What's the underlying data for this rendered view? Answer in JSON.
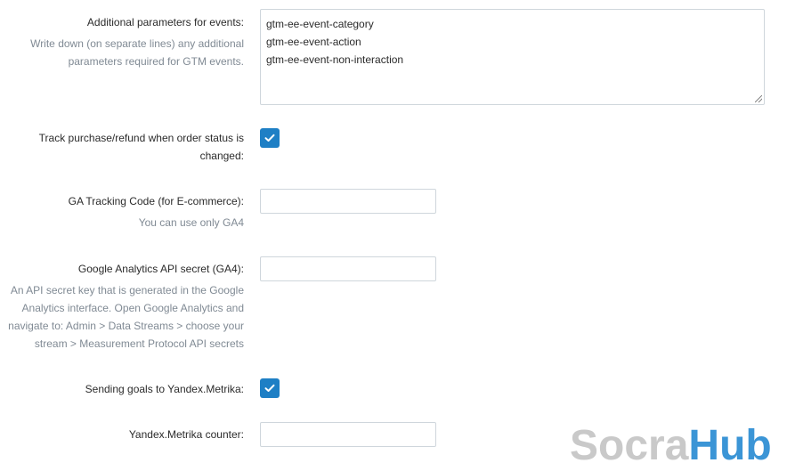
{
  "fields": {
    "additional_params": {
      "label": "Additional parameters for events:",
      "hint_line1": "Write down (on separate lines) any additional",
      "hint_line2": "parameters required for GTM events.",
      "lines": [
        "gtm-ee-event-category",
        "gtm-ee-event-action",
        "gtm-ee-event-non-interaction"
      ]
    },
    "track_purchase": {
      "label_line1": "Track purchase/refund when order status is",
      "label_line2": "changed:",
      "checked": true
    },
    "ga_tracking_code": {
      "label": "GA Tracking Code (for E-commerce):",
      "hint": "You can use only GA4",
      "value": ""
    },
    "ga_api_secret": {
      "label": "Google Analytics API secret (GA4):",
      "hint_line1": "An API secret key that is generated in the Google",
      "hint_line2": "Analytics interface. Open Google Analytics and",
      "hint_line3": "navigate to: Admin > Data Streams > choose your",
      "hint_line4": "stream > Measurement Protocol API secrets",
      "value": ""
    },
    "yandex_goals": {
      "label": "Sending goals to Yandex.Metrika:",
      "checked": true
    },
    "yandex_counter": {
      "label": "Yandex.Metrika counter:",
      "value": ""
    }
  },
  "watermark": {
    "part1": "Socra",
    "part2": "Hub"
  },
  "colors": {
    "checkbox": "#1e7fc5",
    "hint": "#808a94",
    "logo_gray": "#c9c9c9",
    "logo_blue": "#3b95d6"
  }
}
